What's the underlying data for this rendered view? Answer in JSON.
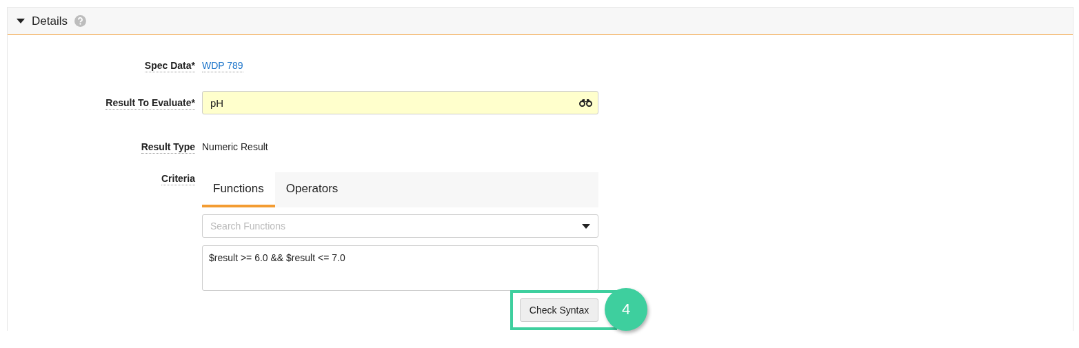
{
  "panel": {
    "title": "Details",
    "expanded": true
  },
  "fields": [
    {
      "kind": "link",
      "label": "Spec Data*",
      "value": "WDP 789"
    },
    {
      "kind": "lookup",
      "label": "Result To Evaluate*",
      "value": "pH"
    },
    {
      "kind": "text",
      "label": "Result Type",
      "value": "Numeric Result"
    },
    {
      "kind": "criteria",
      "label": "Criteria"
    }
  ],
  "criteria": {
    "tabs": [
      {
        "label": "Functions",
        "selected": true
      },
      {
        "label": "Operators",
        "selected": false
      }
    ],
    "search": {
      "placeholder": "Search Functions"
    },
    "expression": "$result >= 6.0 && $result <= 7.0",
    "check_button": "Check Syntax"
  },
  "annotation": {
    "step": "4"
  }
}
